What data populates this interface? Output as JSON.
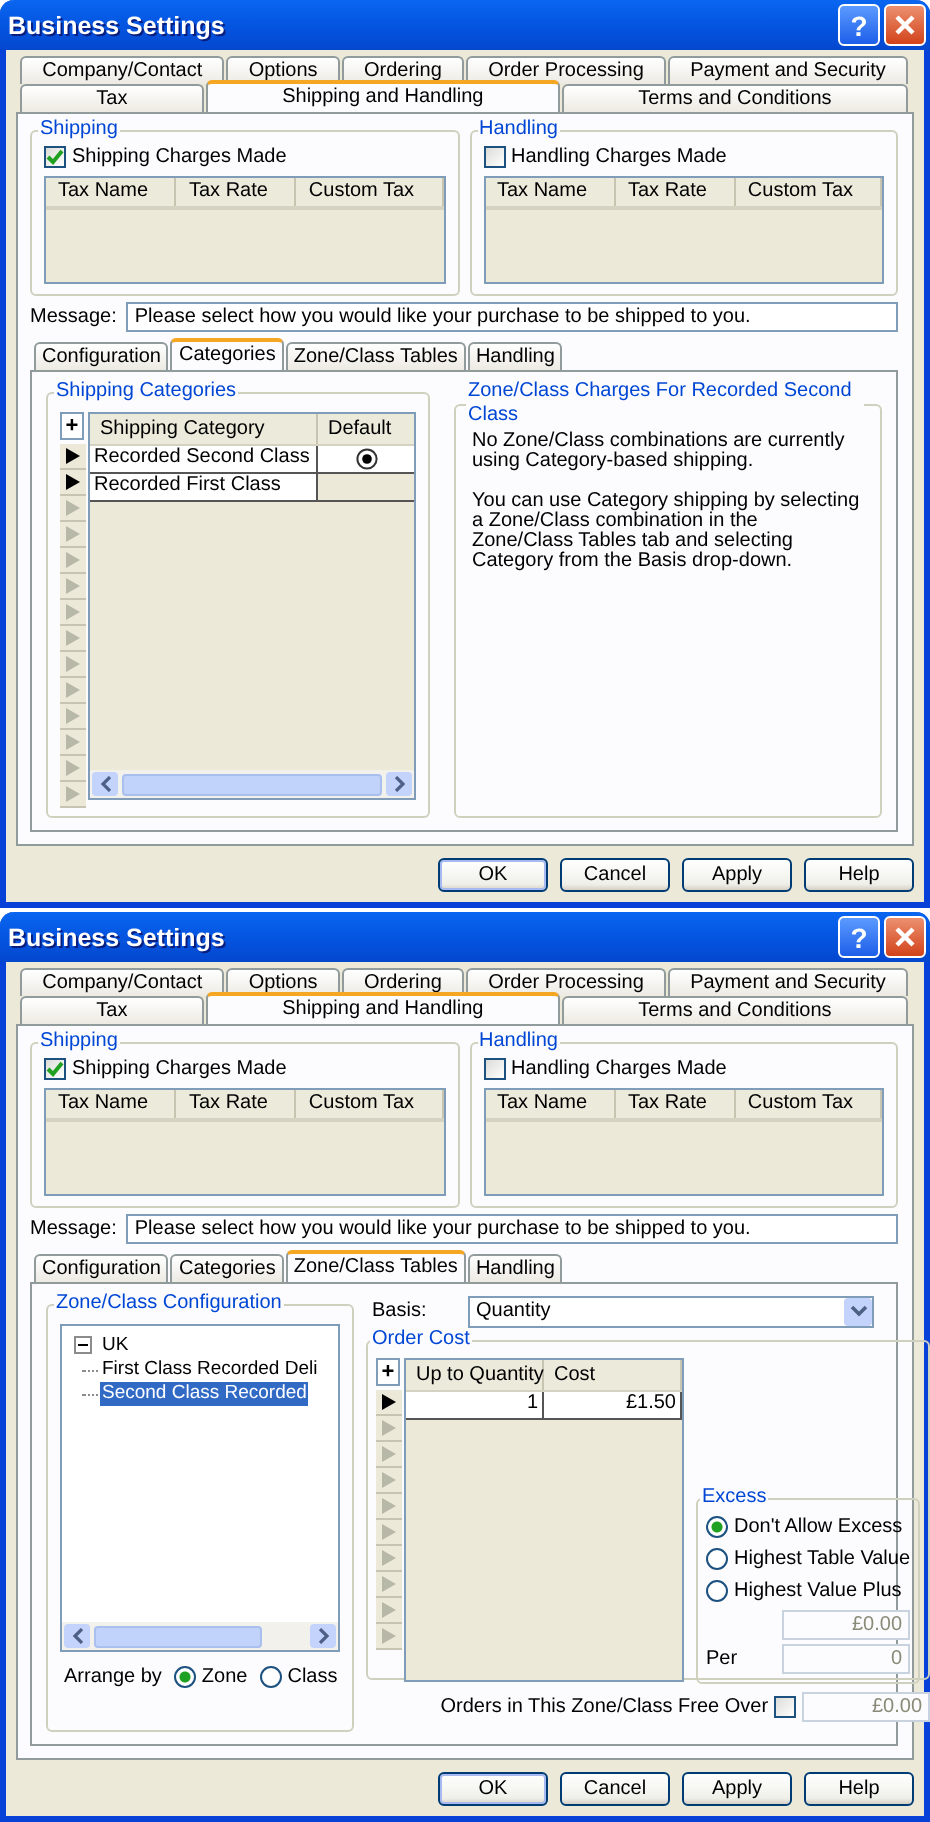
{
  "windows": [
    {
      "title": "Business Settings",
      "help_button": "?",
      "tab_rows": [
        [
          {
            "label": "Company/Contact",
            "selected": false
          },
          {
            "label": "Options",
            "selected": false
          },
          {
            "label": "Ordering",
            "selected": false
          },
          {
            "label": "Order Processing",
            "selected": false
          },
          {
            "label": "Payment and Security",
            "selected": false
          }
        ],
        [
          {
            "label": "Tax",
            "selected": false
          },
          {
            "label": "Shipping and Handling",
            "selected": true
          },
          {
            "label": "Terms and Conditions",
            "selected": false
          }
        ]
      ],
      "groups": [
        {
          "title": "Shipping",
          "checkbox": {
            "label": "Shipping Charges Made",
            "checked": true
          },
          "columns": [
            "Tax Name",
            "Tax Rate",
            "Custom Tax"
          ]
        },
        {
          "title": "Handling",
          "checkbox": {
            "label": "Handling Charges Made",
            "checked": false
          },
          "columns": [
            "Tax Name",
            "Tax Rate",
            "Custom Tax"
          ]
        }
      ],
      "message": {
        "label": "Message:",
        "value": "Please select how you would like your purchase to be shipped to you."
      },
      "sub_tabs": [
        {
          "label": "Configuration",
          "selected": false
        },
        {
          "label": "Categories",
          "selected": true
        },
        {
          "label": "Zone/Class Tables",
          "selected": false
        },
        {
          "label": "Handling",
          "selected": false
        }
      ],
      "panel": {
        "kind": "categories",
        "categories_title": "Shipping Categories",
        "add_button": "+",
        "columns": [
          "Shipping Category",
          "Default"
        ],
        "rows": [
          {
            "name": "Recorded Second Class",
            "default": true
          },
          {
            "name": "Recorded First Class",
            "default": false
          }
        ],
        "charges_title": "Zone/Class Charges For Recorded Second Class",
        "paragraphs": [
          "No Zone/Class combinations are currently using Category-based shipping.",
          "You can use Category shipping by selecting a Zone/Class combination in the Zone/Class Tables tab and selecting Category from the Basis drop-down."
        ]
      },
      "buttons": [
        "OK",
        "Cancel",
        "Apply",
        "Help"
      ]
    },
    {
      "title": "Business Settings",
      "help_button": "?",
      "tab_rows": [
        [
          {
            "label": "Company/Contact",
            "selected": false
          },
          {
            "label": "Options",
            "selected": false
          },
          {
            "label": "Ordering",
            "selected": false
          },
          {
            "label": "Order Processing",
            "selected": false
          },
          {
            "label": "Payment and Security",
            "selected": false
          }
        ],
        [
          {
            "label": "Tax",
            "selected": false
          },
          {
            "label": "Shipping and Handling",
            "selected": true
          },
          {
            "label": "Terms and Conditions",
            "selected": false
          }
        ]
      ],
      "groups": [
        {
          "title": "Shipping",
          "checkbox": {
            "label": "Shipping Charges Made",
            "checked": true
          },
          "columns": [
            "Tax Name",
            "Tax Rate",
            "Custom Tax"
          ]
        },
        {
          "title": "Handling",
          "checkbox": {
            "label": "Handling Charges Made",
            "checked": false
          },
          "columns": [
            "Tax Name",
            "Tax Rate",
            "Custom Tax"
          ]
        }
      ],
      "message": {
        "label": "Message:",
        "value": "Please select how you would like your purchase to be shipped to you."
      },
      "sub_tabs": [
        {
          "label": "Configuration",
          "selected": false
        },
        {
          "label": "Categories",
          "selected": false
        },
        {
          "label": "Zone/Class Tables",
          "selected": true
        },
        {
          "label": "Handling",
          "selected": false
        }
      ],
      "panel": {
        "kind": "zone_tables",
        "config_title": "Zone/Class Configuration",
        "tree": [
          {
            "label": "UK",
            "expanded": true,
            "children": [
              {
                "label": "First Class Recorded Deli",
                "selected": false
              },
              {
                "label": "Second Class Recorded",
                "selected": true
              }
            ]
          }
        ],
        "arrange": {
          "label": "Arrange by",
          "options": [
            {
              "label": "Zone",
              "selected": true
            },
            {
              "label": "Class",
              "selected": false
            }
          ]
        },
        "basis": {
          "label": "Basis:",
          "value": "Quantity"
        },
        "order_cost": {
          "title": "Order Cost",
          "add_button": "+",
          "columns": [
            "Up to Quantity",
            "Cost"
          ],
          "rows": [
            [
              "1",
              "£1.50"
            ]
          ]
        },
        "excess": {
          "title": "Excess",
          "options": [
            {
              "label": "Don't Allow Excess",
              "selected": true
            },
            {
              "label": "Highest Table Value",
              "selected": false
            },
            {
              "label": "Highest Value Plus",
              "selected": false
            }
          ],
          "plus_field": {
            "value": "£0.00",
            "disabled": true
          },
          "per_field": {
            "label": "Per",
            "value": "0",
            "disabled": true
          }
        },
        "free_over": {
          "label": "Orders in This Zone/Class Free Over",
          "checked": false,
          "field": {
            "value": "£0.00",
            "disabled": true
          }
        }
      },
      "buttons": [
        "OK",
        "Cancel",
        "Apply",
        "Help"
      ]
    }
  ]
}
